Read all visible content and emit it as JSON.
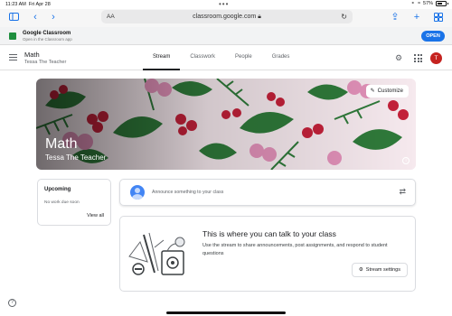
{
  "status_bar": {
    "time": "11:23 AM",
    "date": "Fri Apr 28",
    "battery": "57%"
  },
  "browser": {
    "text_size_label": "AA",
    "url": "classroom.google.com"
  },
  "app_banner": {
    "title": "Google Classroom",
    "subtitle": "Open in the Classroom app",
    "open_label": "OPEN"
  },
  "header": {
    "class_name": "Math",
    "teacher": "Tessa The Teacher",
    "tabs": [
      {
        "label": "Stream",
        "active": true
      },
      {
        "label": "Classwork",
        "active": false
      },
      {
        "label": "People",
        "active": false
      },
      {
        "label": "Grades",
        "active": false
      }
    ],
    "avatar_letter": "T"
  },
  "hero": {
    "title": "Math",
    "teacher": "Tessa The Teacher",
    "customize_label": "Customize"
  },
  "upcoming": {
    "heading": "Upcoming",
    "empty_text": "No work due soon",
    "view_all": "View all"
  },
  "announce": {
    "placeholder": "Announce something to your class"
  },
  "talk": {
    "title": "This is where you can talk to your class",
    "description": "Use the stream to share announcements, post assignments, and respond to student questions",
    "settings_label": "Stream settings"
  },
  "colors": {
    "accent": "#1a73e8",
    "avatar": "#c5221f",
    "classroom_green": "#1e8e3e"
  }
}
